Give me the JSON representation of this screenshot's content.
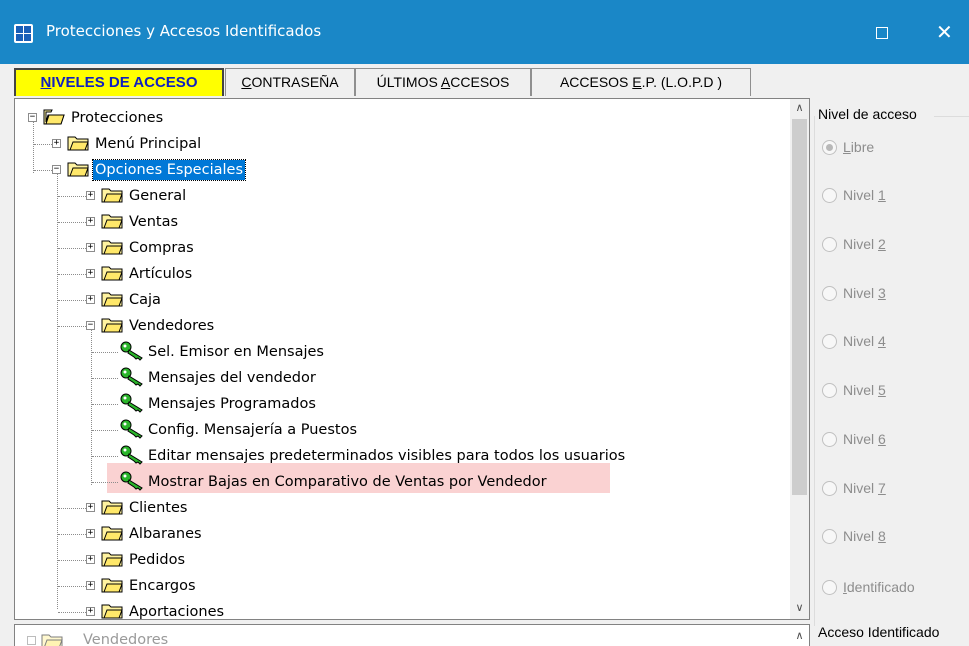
{
  "window": {
    "title": "Protecciones y Accesos Identificados",
    "colors": {
      "titlebar": "#1a87c7",
      "active_tab": "#ffff00",
      "selection": "#0078d7",
      "highlight": "#fad2d2"
    }
  },
  "tabs": [
    {
      "pre": "",
      "ul": "N",
      "post": "IVELES DE ACCESO",
      "active": true
    },
    {
      "pre": "",
      "ul": "C",
      "post": "ONTRASEÑA",
      "active": false
    },
    {
      "pre": "ÚLTIMOS ",
      "ul": "A",
      "post": "CCESOS",
      "active": false
    },
    {
      "pre": "ACCESOS ",
      "ul": "E",
      "post": ".P. (L.O.P.D )",
      "active": false
    }
  ],
  "tree": {
    "root": "Protecciones",
    "items": [
      {
        "label": "Menú Principal",
        "icon": "folder-icon",
        "state": "collapsed"
      },
      {
        "label": "Opciones Especiales",
        "icon": "folder-icon",
        "state": "expanded",
        "selected": true
      },
      {
        "label": "General",
        "icon": "folder-icon",
        "state": "collapsed"
      },
      {
        "label": "Ventas",
        "icon": "folder-icon",
        "state": "collapsed"
      },
      {
        "label": "Compras",
        "icon": "folder-icon",
        "state": "collapsed"
      },
      {
        "label": "Artículos",
        "icon": "folder-icon",
        "state": "collapsed"
      },
      {
        "label": "Caja",
        "icon": "folder-icon",
        "state": "collapsed"
      },
      {
        "label": "Vendedores",
        "icon": "folder-icon",
        "state": "expanded"
      },
      {
        "label": "Sel. Emisor en Mensajes",
        "icon": "key-icon"
      },
      {
        "label": "Mensajes del vendedor",
        "icon": "key-icon"
      },
      {
        "label": "Mensajes Programados",
        "icon": "key-icon"
      },
      {
        "label": "Config. Mensajería a Puestos",
        "icon": "key-icon"
      },
      {
        "label": "Editar mensajes predeterminados visibles para todos los usuarios",
        "icon": "key-icon"
      },
      {
        "label": "Mostrar Bajas en Comparativo de Ventas por Vendedor",
        "icon": "key-icon",
        "highlighted": true
      },
      {
        "label": "Clientes",
        "icon": "folder-icon",
        "state": "collapsed"
      },
      {
        "label": "Albaranes",
        "icon": "folder-icon",
        "state": "collapsed"
      },
      {
        "label": "Pedidos",
        "icon": "folder-icon",
        "state": "collapsed"
      },
      {
        "label": "Encargos",
        "icon": "folder-icon",
        "state": "collapsed"
      },
      {
        "label": "Aportaciones",
        "icon": "folder-icon",
        "state": "collapsed"
      }
    ]
  },
  "nivel_acceso": {
    "title": "Nivel de acceso",
    "options": [
      {
        "pre": "",
        "ul": "L",
        "post": "ibre",
        "checked": true
      },
      {
        "pre": "Nivel ",
        "ul": "1",
        "post": ""
      },
      {
        "pre": "Nivel ",
        "ul": "2",
        "post": ""
      },
      {
        "pre": "Nivel ",
        "ul": "3",
        "post": ""
      },
      {
        "pre": "Nivel ",
        "ul": "4",
        "post": ""
      },
      {
        "pre": "Nivel ",
        "ul": "5",
        "post": ""
      },
      {
        "pre": "Nivel ",
        "ul": "6",
        "post": ""
      },
      {
        "pre": "Nivel ",
        "ul": "7",
        "post": ""
      },
      {
        "pre": "Nivel ",
        "ul": "8",
        "post": ""
      },
      {
        "pre": "",
        "ul": "I",
        "post": "dentificado"
      }
    ]
  },
  "bottom": {
    "tree_label": "Vendedores",
    "acceso_title": "Acceso Identificado"
  }
}
